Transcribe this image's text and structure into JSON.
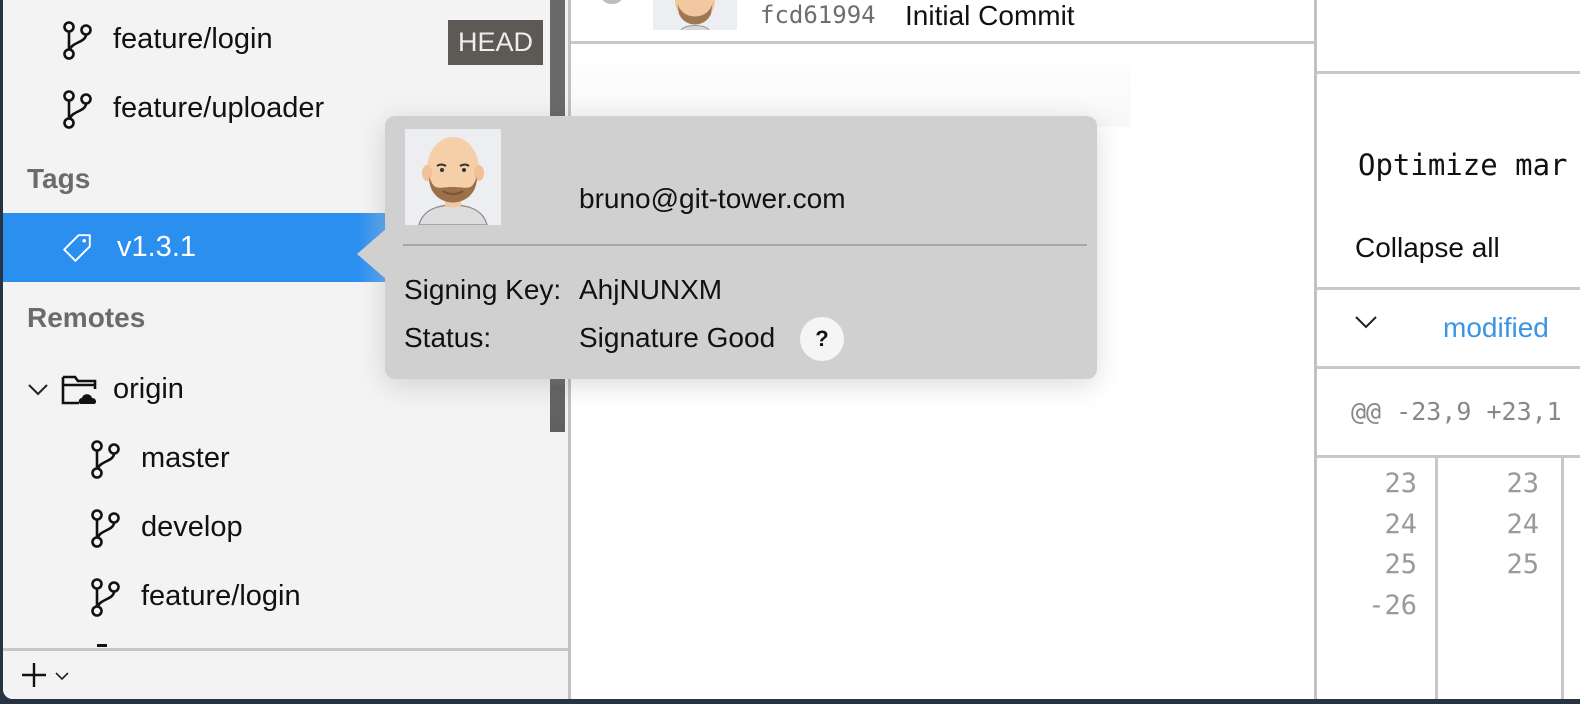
{
  "sidebar": {
    "branches": [
      {
        "name": "feature/login",
        "badge": "HEAD",
        "icon": "branch-icon"
      },
      {
        "name": "feature/uploader",
        "icon": "branch-icon"
      }
    ],
    "tags_heading": "Tags",
    "tags": [
      {
        "name": "v1.3.1",
        "icon": "tag-icon",
        "selected": true
      }
    ],
    "remotes_heading": "Remotes",
    "remotes": [
      {
        "name": "origin",
        "icon": "cloud-folder-icon",
        "expanded": true,
        "branches": [
          {
            "name": "master",
            "icon": "branch-icon"
          },
          {
            "name": "develop",
            "icon": "branch-icon"
          },
          {
            "name": "feature/login",
            "icon": "branch-icon"
          }
        ]
      }
    ],
    "footer": {
      "add_icon": "plus-icon",
      "dropdown_icon": "chevron-down-icon"
    }
  },
  "history": {
    "commits": [
      {
        "hash": "fcd61994",
        "message": "Initial Commit"
      }
    ]
  },
  "popover": {
    "email": "bruno@git-tower.com",
    "signing_key_label": "Signing Key:",
    "signing_key_value": "AhjNUNXM",
    "status_label": "Status:",
    "status_value": "Signature Good",
    "help_label": "?"
  },
  "details": {
    "title": "Optimize mar",
    "collapse_all": "Collapse all",
    "file_status": "modified",
    "hunk_header": "@@ -23,9 +23,1",
    "old_lines": [
      "23",
      "24",
      "25",
      "-26"
    ],
    "new_lines": [
      "23",
      "24",
      "25",
      ""
    ]
  },
  "colors": {
    "selection": "#2b8ff0",
    "head_badge": "#5d5955",
    "modified": "#3a95e6"
  }
}
